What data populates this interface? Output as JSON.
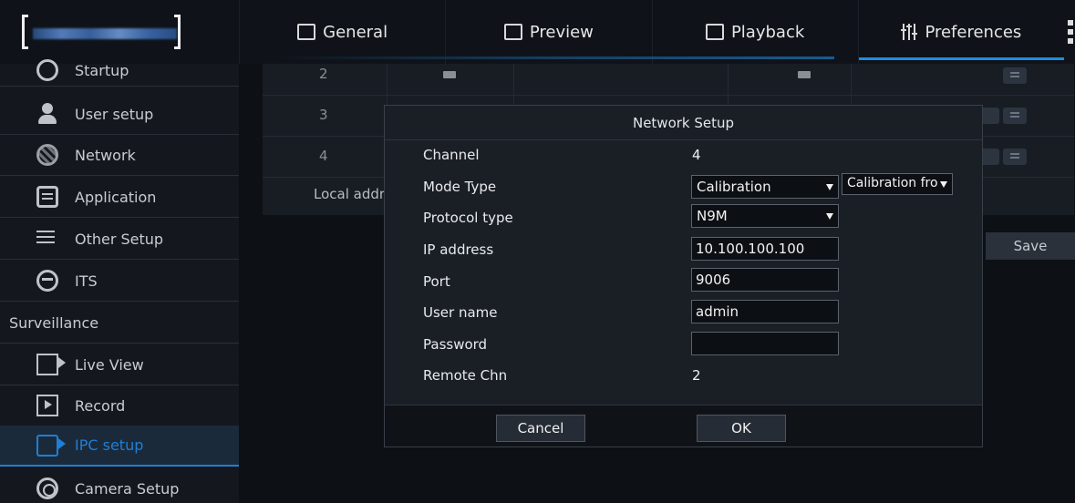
{
  "header": {
    "tabs": [
      {
        "label": "General",
        "icon": "grid-icon"
      },
      {
        "label": "Preview",
        "icon": "monitor-icon"
      },
      {
        "label": "Playback",
        "icon": "film-icon"
      },
      {
        "label": "Preferences",
        "icon": "sliders-icon",
        "active": true
      }
    ],
    "accent_color": "#1e8de0"
  },
  "sidebar": {
    "items": [
      {
        "label": "Startup",
        "icon": "power-icon"
      },
      {
        "label": "User setup",
        "icon": "user-icon"
      },
      {
        "label": "Network",
        "icon": "globe-icon"
      },
      {
        "label": "Application",
        "icon": "application-icon"
      },
      {
        "label": "Other Setup",
        "icon": "settings-icon"
      },
      {
        "label": "ITS",
        "icon": "steering-icon"
      },
      {
        "label": "Surveillance",
        "section": true
      },
      {
        "label": "Live View",
        "icon": "camera-icon"
      },
      {
        "label": "Record",
        "icon": "record-icon"
      },
      {
        "label": "IPC setup",
        "icon": "ipc-icon",
        "active": true
      },
      {
        "label": "Camera Setup",
        "icon": "webcam-icon"
      }
    ]
  },
  "background_table": {
    "rows": [
      "2",
      "3",
      "4"
    ],
    "local_address_label": "Local addr",
    "save_label": "Save"
  },
  "dialog": {
    "title": "Network Setup",
    "channel_label": "Channel",
    "channel_value": "4",
    "mode_type_label": "Mode Type",
    "mode_type_value": "Calibration",
    "mode_type_secondary": "Calibration fro",
    "protocol_label": "Protocol type",
    "protocol_value": "N9M",
    "ip_label": "IP address",
    "ip_value": "10.100.100.100",
    "port_label": "Port",
    "port_value": "9006",
    "username_label": "User name",
    "username_value": "admin",
    "password_label": "Password",
    "password_value": "",
    "remote_chn_label": "Remote Chn",
    "remote_chn_value": "2",
    "cancel_label": "Cancel",
    "ok_label": "OK"
  }
}
